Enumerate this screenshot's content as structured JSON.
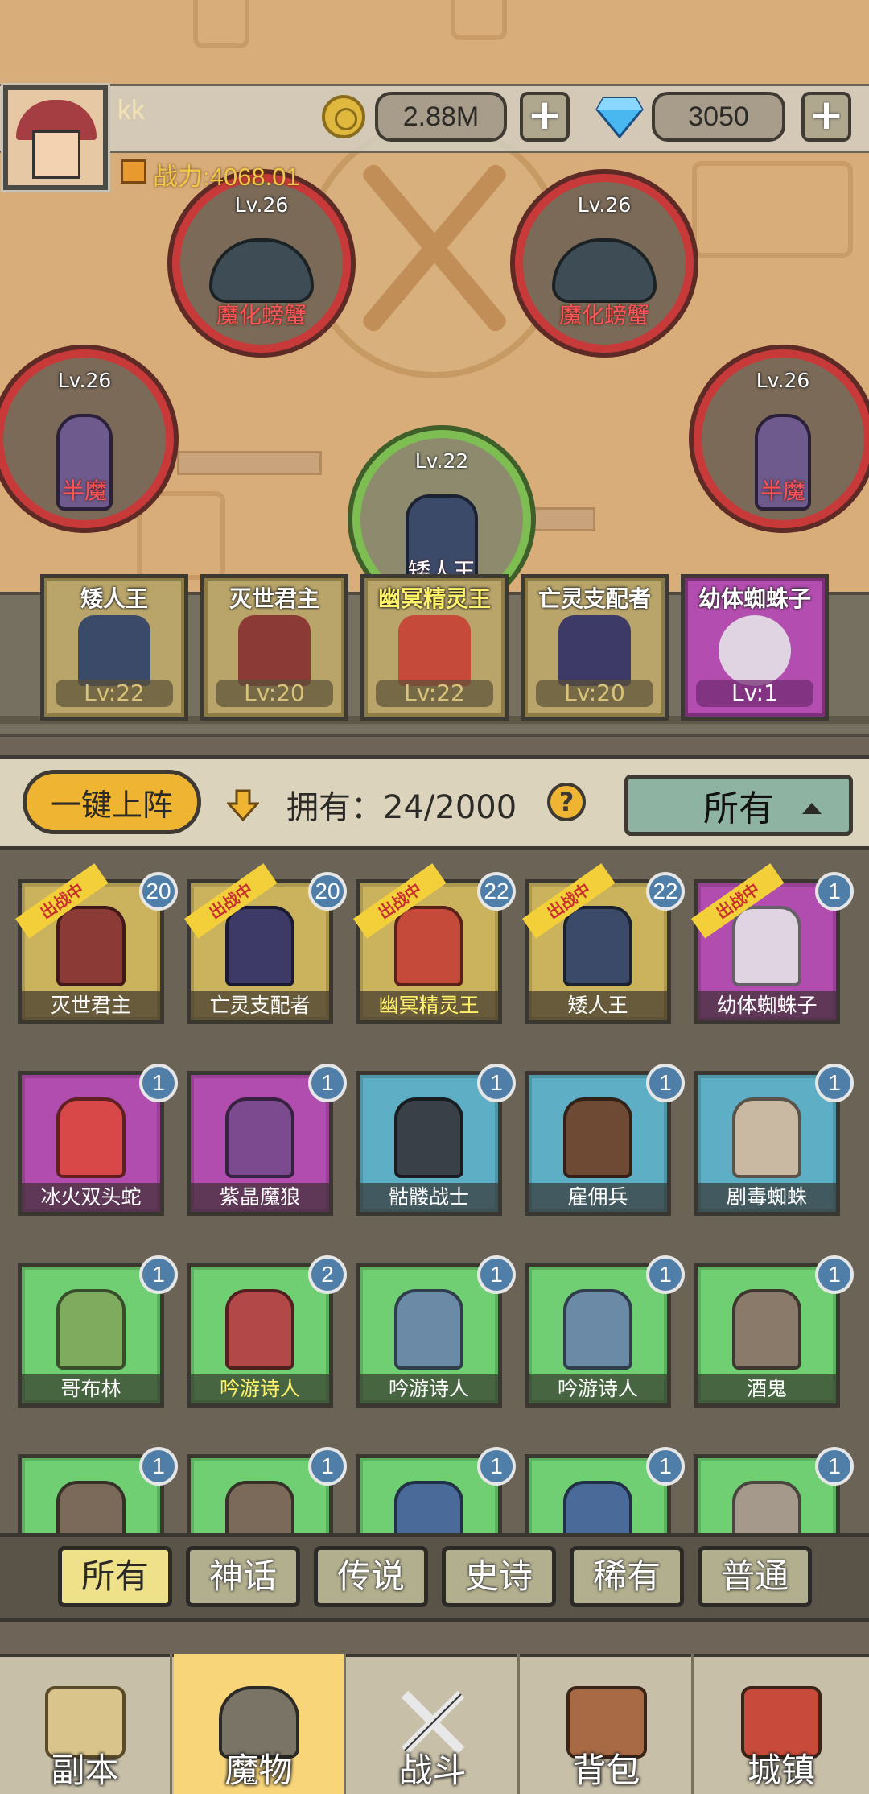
{
  "player": {
    "name": "kk",
    "gold": "2.88M",
    "gems": "3050",
    "power": "战力:4068.01"
  },
  "map_enemies": [
    {
      "level": "Lv.26",
      "name": "魔化螃蟹"
    },
    {
      "level": "Lv.26",
      "name": "魔化螃蟹"
    },
    {
      "level": "Lv.26",
      "name": "半魔"
    },
    {
      "level": "Lv.26",
      "name": "半魔"
    },
    {
      "level": "Lv.22",
      "name": "矮人王"
    }
  ],
  "team": [
    {
      "name": "矮人王",
      "level": "Lv:22"
    },
    {
      "name": "灭世君主",
      "level": "Lv:20"
    },
    {
      "name": "幽冥精灵王",
      "level": "Lv:22"
    },
    {
      "name": "亡灵支配者",
      "level": "Lv:20"
    },
    {
      "name": "幼体蜘蛛子",
      "level": "Lv:1"
    }
  ],
  "controls": {
    "one_key": "一键上阵",
    "owned": "拥有：24/2000",
    "help": "?",
    "filter": "所有"
  },
  "in_battle_label": "出战中",
  "monsters": [
    {
      "name": "灭世君主",
      "count": "20"
    },
    {
      "name": "亡灵支配者",
      "count": "20"
    },
    {
      "name": "幽冥精灵王",
      "count": "22"
    },
    {
      "name": "矮人王",
      "count": "22"
    },
    {
      "name": "幼体蜘蛛子",
      "count": "1"
    },
    {
      "name": "冰火双头蛇",
      "count": "1"
    },
    {
      "name": "紫晶魔狼",
      "count": "1"
    },
    {
      "name": "骷髅战士",
      "count": "1"
    },
    {
      "name": "雇佣兵",
      "count": "1"
    },
    {
      "name": "剧毒蜘蛛",
      "count": "1"
    },
    {
      "name": "哥布林",
      "count": "1"
    },
    {
      "name": "吟游诗人",
      "count": "2"
    },
    {
      "name": "吟游诗人",
      "count": "1"
    },
    {
      "name": "吟游诗人",
      "count": "1"
    },
    {
      "name": "酒鬼",
      "count": "1"
    },
    {
      "name": "",
      "count": "1"
    },
    {
      "name": "",
      "count": "1"
    },
    {
      "name": "",
      "count": "1"
    },
    {
      "name": "",
      "count": "1"
    },
    {
      "name": "",
      "count": "1"
    }
  ],
  "rarity_tabs": [
    "所有",
    "神话",
    "传说",
    "史诗",
    "稀有",
    "普通"
  ],
  "nav": [
    "副本",
    "魔物",
    "战斗",
    "背包",
    "城镇"
  ],
  "colors": {
    "gold": "#efb532",
    "enemy_ring": "#c83a3a",
    "ally_ring": "#7dbd52"
  }
}
